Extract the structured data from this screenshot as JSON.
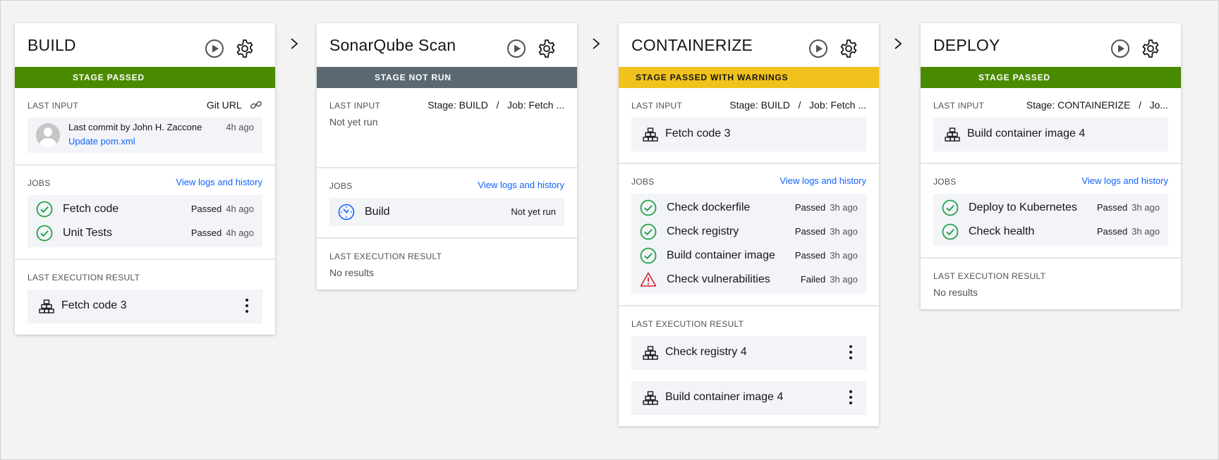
{
  "stages": [
    {
      "title": "BUILD",
      "status": "STAGE PASSED",
      "last_input": {
        "label": "LAST INPUT",
        "source": "Git URL",
        "commit_text": "Last commit by John H. Zaccone",
        "commit_time": "4h ago",
        "commit_link": "Update pom.xml"
      },
      "jobs": {
        "label": "JOBS",
        "link": "View logs and history",
        "items": [
          {
            "name": "Fetch code",
            "status": "Passed",
            "time": "4h ago",
            "icon": "check-circle-icon"
          },
          {
            "name": "Unit Tests",
            "status": "Passed",
            "time": "4h ago",
            "icon": "check-circle-icon"
          }
        ]
      },
      "result": {
        "label": "LAST EXECUTION RESULT",
        "items": [
          "Fetch code 3"
        ]
      }
    },
    {
      "title": "SonarQube Scan",
      "status": "STAGE NOT RUN",
      "last_input": {
        "label": "LAST INPUT",
        "source": "Stage: BUILD   /   Job: Fetch ...",
        "text": "Not yet run"
      },
      "jobs": {
        "label": "JOBS",
        "link": "View logs and history",
        "items": [
          {
            "name": "Build",
            "status": "Not yet run",
            "time": "",
            "icon": "clock-icon"
          }
        ]
      },
      "result": {
        "label": "LAST EXECUTION RESULT",
        "text": "No results"
      }
    },
    {
      "title": "CONTAINERIZE",
      "status": "STAGE PASSED WITH WARNINGS",
      "last_input": {
        "label": "LAST INPUT",
        "source": "Stage: BUILD   /   Job: Fetch ...",
        "artifact": "Fetch code 3"
      },
      "jobs": {
        "label": "JOBS",
        "link": "View logs and history",
        "items": [
          {
            "name": "Check dockerfile",
            "status": "Passed",
            "time": "3h ago",
            "icon": "check-circle-icon"
          },
          {
            "name": "Check registry",
            "status": "Passed",
            "time": "3h ago",
            "icon": "check-circle-icon"
          },
          {
            "name": "Build container image",
            "status": "Passed",
            "time": "3h ago",
            "icon": "check-circle-icon"
          },
          {
            "name": "Check vulnerabilities",
            "status": "Failed",
            "time": "3h ago",
            "icon": "warning-icon"
          }
        ]
      },
      "result": {
        "label": "LAST EXECUTION RESULT",
        "items": [
          "Check registry 4",
          "Build container image 4"
        ]
      }
    },
    {
      "title": "DEPLOY",
      "status": "STAGE PASSED",
      "last_input": {
        "label": "LAST INPUT",
        "source": "Stage: CONTAINERIZE   /   Jo...",
        "artifact": "Build container image 4"
      },
      "jobs": {
        "label": "JOBS",
        "link": "View logs and history",
        "items": [
          {
            "name": "Deploy to Kubernetes",
            "status": "Passed",
            "time": "3h ago",
            "icon": "check-circle-icon"
          },
          {
            "name": "Check health",
            "status": "Passed",
            "time": "3h ago",
            "icon": "check-circle-icon"
          }
        ]
      },
      "result": {
        "label": "LAST EXECUTION RESULT",
        "text": "No results"
      }
    }
  ],
  "colors": {
    "passed": "#4a8a00",
    "not_run": "#5a6872",
    "warning": "#f1c21b",
    "link": "#0f62fe",
    "failed": "#da1e28"
  }
}
